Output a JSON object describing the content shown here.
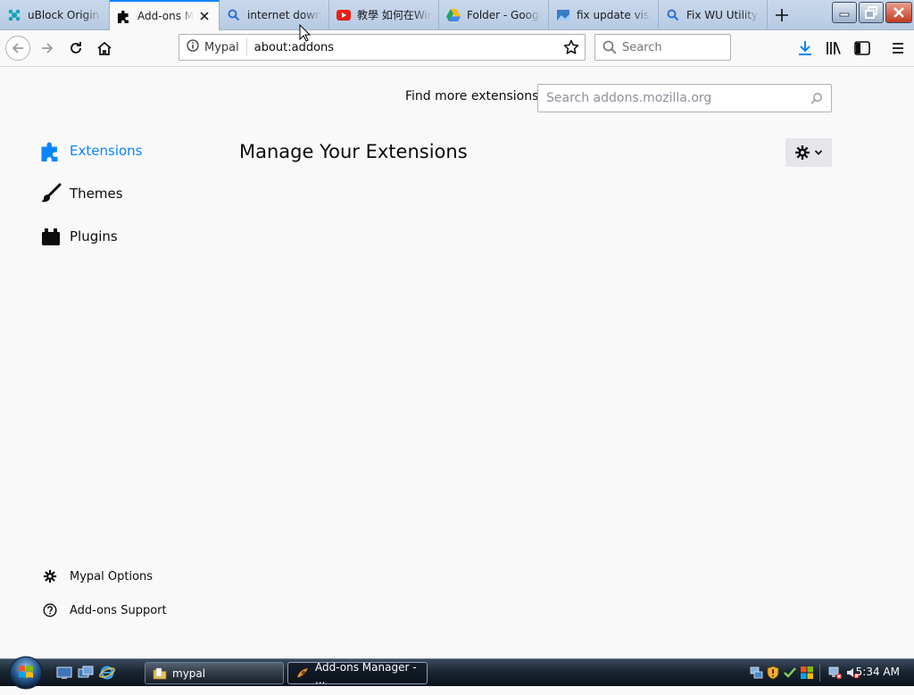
{
  "tabs": [
    {
      "label": "uBlock Origin – Get this Extension",
      "icon": "ublock-icon",
      "selected": false
    },
    {
      "label": "Add-ons Manager",
      "icon": "puzzle-icon",
      "selected": true
    },
    {
      "label": "internet download manager",
      "icon": "search-icon",
      "selected": false
    },
    {
      "label": "教學 如何在Windows",
      "icon": "youtube-icon",
      "selected": false
    },
    {
      "label": "Folder - Google Drive",
      "icon": "google-drive-icon",
      "selected": false
    },
    {
      "label": "fix update vista",
      "icon": "bookmark-icon",
      "selected": false
    },
    {
      "label": "Fix WU Utility",
      "icon": "search-icon",
      "selected": false
    }
  ],
  "navbar": {
    "identity_label": "Mypal",
    "url": "about:addons",
    "search_placeholder": "Search"
  },
  "content": {
    "find_more_label": "Find more extensions",
    "amo_search_placeholder": "Search addons.mozilla.org",
    "heading": "Manage Your Extensions",
    "categories": [
      {
        "label": "Extensions",
        "icon": "puzzle-icon",
        "selected": true
      },
      {
        "label": "Themes",
        "icon": "brush-icon",
        "selected": false
      },
      {
        "label": "Plugins",
        "icon": "plugin-icon",
        "selected": false
      }
    ],
    "footer_links": [
      {
        "label": "Mypal Options",
        "icon": "gear-icon"
      },
      {
        "label": "Add-ons Support",
        "icon": "help-icon"
      }
    ]
  },
  "taskbar": {
    "buttons": [
      {
        "label": "mypal",
        "icon": "folder-icon",
        "active": false
      },
      {
        "label": "Add-ons Manager - ...",
        "icon": "mypal-icon",
        "active": true
      }
    ],
    "clock": "5:34 AM"
  },
  "colors": {
    "accent": "#0a84ff",
    "text": "#0c0c0d",
    "content_background": "#f9f9fa"
  }
}
